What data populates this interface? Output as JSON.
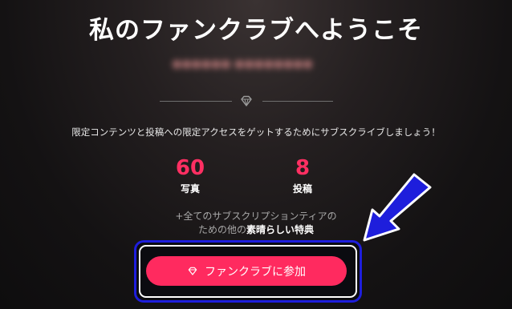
{
  "header": {
    "title": "私のファンクラブへようこそ",
    "subtitle_blurred": "●●●●●● ●●●●●●●●"
  },
  "description": "限定コンテンツと投稿への限定アクセスをゲットするためにサブスクライブしましょう！",
  "stats": {
    "photos": {
      "value": "60",
      "label": "写真"
    },
    "posts": {
      "value": "8",
      "label": "投稿"
    }
  },
  "benefit": {
    "line1": "+全てのサブスクリプションティアの",
    "line2_prefix": "ための他の",
    "line2_highlight": "素晴らしい特典"
  },
  "join_button": {
    "label": "ファンクラブに参加",
    "icon": "gem-icon"
  },
  "colors": {
    "accent": "#ff2a5f",
    "stat_value": "#ff2f62",
    "annotation_blue": "#1e1edc"
  }
}
